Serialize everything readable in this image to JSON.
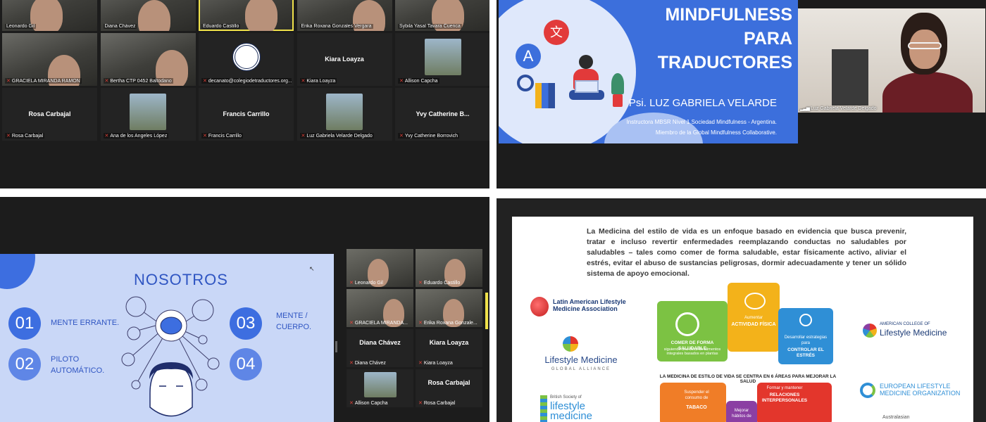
{
  "gallery_top": {
    "tiles": [
      {
        "name": "Leonardo Gil",
        "type": "video"
      },
      {
        "name": "Diana Chávez",
        "type": "video"
      },
      {
        "name": "Eduardo Castillo",
        "type": "video",
        "active": true
      },
      {
        "name": "Erika Roxana Gonzales Vergara",
        "type": "video"
      },
      {
        "name": "Sybila Yasal Tavara Cuenca",
        "type": "video"
      },
      {
        "name": "GRACIELA MIRANDA RAMON",
        "type": "video"
      },
      {
        "name": "Bertha CTP 0452 Baltodano",
        "type": "video"
      },
      {
        "name": "decanato@colegiodetraductores.org...",
        "type": "logo"
      },
      {
        "name": "Kiara Loayza",
        "type": "text",
        "display": "Kiara Loayza"
      },
      {
        "name": "Allison Capcha",
        "type": "photo"
      },
      {
        "name": "Rosa Carbajal",
        "type": "text",
        "display": "Rosa Carbajal"
      },
      {
        "name": "Ana de los Angeles López",
        "type": "photo"
      },
      {
        "name": "Francis Carrillo",
        "type": "text",
        "display": "Francis Carrillo"
      },
      {
        "name": "Luz Gabriela Velarde Delgado",
        "type": "photo"
      },
      {
        "name": "Yvy Catherine Borrovich",
        "type": "text",
        "display": "Yvy Catherine B..."
      }
    ]
  },
  "mindfulness_slide": {
    "title_lines": [
      "MINDFULNESS",
      "PARA",
      "TRADUCTORES"
    ],
    "author": "Psi. LUZ GABRIELA VELARDE",
    "desc1": "Instructora MBSR Nivel 1 Sociedad Mindfulness - Argentina.",
    "desc2": "Miembro de la Global Mindfulness Collaborative.",
    "icon_letter_a": "A",
    "icon_letter_wen": "文",
    "presenter_name": "Luz Gabriela Velarde Delgado"
  },
  "nosotros_slide": {
    "title": "NOSOTROS",
    "items": [
      {
        "num": "01",
        "label": "MENTE  ERRANTE."
      },
      {
        "num": "02",
        "label": "PILOTO AUTOMÁTICO."
      },
      {
        "num": "03",
        "label": "MENTE / CUERPO."
      },
      {
        "num": "04",
        "label": ""
      }
    ]
  },
  "gallery_side": {
    "tiles": [
      {
        "name": "Leonardo Gil",
        "type": "video"
      },
      {
        "name": "Eduardo Castillo",
        "type": "video"
      },
      {
        "name": "GRACIELA MIRANDA...",
        "type": "video"
      },
      {
        "name": "Erika Roxana Gonzale...",
        "type": "video"
      },
      {
        "name": "Diana Chávez",
        "type": "text",
        "display": "Diana Chávez"
      },
      {
        "name": "Kiara Loayza",
        "type": "text",
        "display": "Kiara Loayza"
      },
      {
        "name": "Allison Capcha",
        "type": "photo"
      },
      {
        "name": "Rosa Carbajal",
        "type": "text",
        "display": "Rosa Carbajal"
      }
    ]
  },
  "lifestyle_slide": {
    "paragraph": "La Medicina del estilo de vida es un enfoque basado en evidencia que busca prevenir, tratar e incluso revertir enfermedades reemplazando conductas no saludables por saludables – tales como comer de forma saludable, estar físicamente activo, aliviar el estrés, evitar el abuso de sustancias peligrosas, dormir adecuadamente y tener un sólido sistema de apoyo emocional.",
    "logos": {
      "lalm": "Latin American Lifestyle Medicine Association",
      "lmga_top": "Lifestyle Medicine",
      "lmga_sub": "GLOBAL ALLIANCE",
      "bslm_small": "British Society of",
      "bslm": "lifestyle medicine",
      "aclm_small": "AMERICAN COLLEGE OF",
      "aclm": "Lifestyle Medicine",
      "elmo": "EUROPEAN LIFESTYLE MEDICINE ORGANIZATION",
      "australasian": "Australasian"
    },
    "center_text": "LA MEDICINA DE ESTILO DE VIDA SE CENTRA EN 6 ÁREAS PARA MEJORAR LA SALUD",
    "segments": {
      "eat": "COMER DE FORMA SALUDABLE",
      "eat_sub": "siguiendo una dieta de alimentos integrales basados en plantas",
      "activity_pre": "Aumentar",
      "activity": "ACTIVIDAD FÍSICA",
      "stress_pre": "Desarrollar estrategias para",
      "stress": "CONTROLAR EL ESTRÉS",
      "tobacco_pre": "Suspender el consumo de",
      "tobacco": "TABACO",
      "relations_pre": "Formar y mantener",
      "relations": "RELACIONES INTERPERSONALES",
      "sleep_pre": "Mejorar hábitos de"
    }
  },
  "colors": {
    "mindfulness_blue": "#3c6fdc",
    "nosotros_bg": "#c9d7f7",
    "nosotros_circle": "#3d6ee0",
    "nosotros_circle_light": "#5f86e6",
    "seg_green": "#7cc243",
    "seg_yellow": "#f3b21a",
    "seg_blue": "#2f8fd6",
    "seg_orange": "#f07d27",
    "seg_red": "#e3362c",
    "seg_purple": "#8b3fa3",
    "active_outline": "#f0e24a",
    "muted_mic": "#e0443b"
  }
}
